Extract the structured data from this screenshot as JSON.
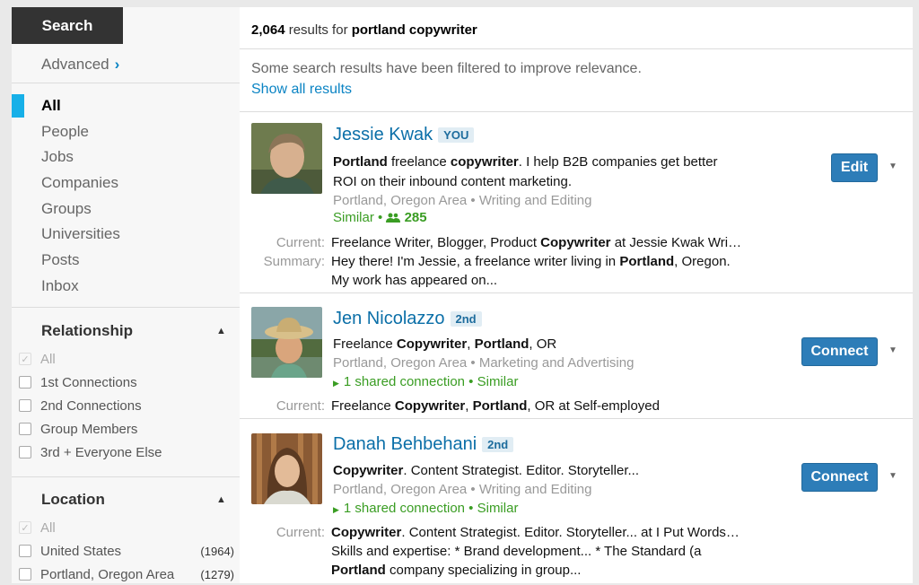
{
  "sidebar": {
    "search_tab": "Search",
    "advanced_label": "Advanced",
    "advanced_chevron": "›",
    "nav_items": [
      {
        "label": "All",
        "active": true
      },
      {
        "label": "People"
      },
      {
        "label": "Jobs"
      },
      {
        "label": "Companies"
      },
      {
        "label": "Groups"
      },
      {
        "label": "Universities"
      },
      {
        "label": "Posts"
      },
      {
        "label": "Inbox"
      }
    ],
    "relationship": {
      "title": "Relationship",
      "caret": "▲",
      "options": [
        {
          "label": "All",
          "checked": true,
          "disabled": true
        },
        {
          "label": "1st Connections"
        },
        {
          "label": "2nd Connections"
        },
        {
          "label": "Group Members"
        },
        {
          "label": "3rd + Everyone Else"
        }
      ]
    },
    "location": {
      "title": "Location",
      "caret": "▲",
      "options": [
        {
          "label": "All",
          "checked": true,
          "disabled": true
        },
        {
          "label": "United States",
          "count": "(1964)"
        },
        {
          "label": "Portland, Oregon Area",
          "count": "(1279)"
        }
      ]
    }
  },
  "main": {
    "results_count": "2,064",
    "results_for": " results for ",
    "query": "portland copywriter",
    "filtered_message": "Some search results have been filtered to improve relevance.",
    "show_all_link": "Show all results",
    "results": [
      {
        "name": "Jessie Kwak",
        "badge": "YOU",
        "headline_parts": [
          {
            "text": "Portland",
            "bold": true
          },
          {
            "text": " freelance "
          },
          {
            "text": "copywriter",
            "bold": true
          },
          {
            "text": ". I help B2B companies get better"
          }
        ],
        "headline_line2": "ROI on their inbound content marketing.",
        "location": "Portland, Oregon Area • Writing and Editing",
        "similar_label": "Similar • ",
        "connections_icon": "people-icon",
        "connections_count": "285",
        "current_label": "Current:",
        "current_parts": [
          {
            "text": "Freelance Writer, Blogger, Product "
          },
          {
            "text": "Copywriter",
            "bold": true
          },
          {
            "text": " at Jessie Kwak Wri…"
          }
        ],
        "summary_label": "Summary:",
        "summary_parts": [
          {
            "text": "Hey there! I'm Jessie, a freelance writer living in "
          },
          {
            "text": "Portland",
            "bold": true
          },
          {
            "text": ", Oregon."
          }
        ],
        "summary_line2": "My work has appeared on...",
        "button_label": "Edit",
        "dropdown": "▼"
      },
      {
        "name": "Jen Nicolazzo",
        "badge": "2nd",
        "headline_parts": [
          {
            "text": "Freelance "
          },
          {
            "text": "Copywriter",
            "bold": true
          },
          {
            "text": ", "
          },
          {
            "text": "Portland",
            "bold": true
          },
          {
            "text": ", OR"
          }
        ],
        "location": "Portland, Oregon Area • Marketing and Advertising",
        "shared_text": "1 shared connection • Similar",
        "current_label": "Current:",
        "current_parts": [
          {
            "text": "Freelance "
          },
          {
            "text": "Copywriter",
            "bold": true
          },
          {
            "text": ", "
          },
          {
            "text": "Portland",
            "bold": true
          },
          {
            "text": ", OR at Self-employed"
          }
        ],
        "button_label": "Connect",
        "dropdown": "▼"
      },
      {
        "name": "Danah Behbehani",
        "badge": "2nd",
        "headline_parts": [
          {
            "text": "Copywriter",
            "bold": true
          },
          {
            "text": ". Content Strategist. Editor. Storyteller..."
          }
        ],
        "location": "Portland, Oregon Area • Writing and Editing",
        "shared_text": "1 shared connection • Similar",
        "current_label": "Current:",
        "current_parts": [
          {
            "text": "Copywriter",
            "bold": true
          },
          {
            "text": ". Content Strategist. Editor. Storyteller... at I Put Words…"
          }
        ],
        "extra_line": "Skills and expertise: * Brand development... * The Standard (a",
        "extra_line2_parts": [
          {
            "text": "Portland",
            "bold": true
          },
          {
            "text": " company specializing in group..."
          }
        ],
        "button_label": "Connect",
        "dropdown": "▼"
      }
    ]
  },
  "colors": {
    "link_blue": "#0b84c4",
    "name_blue": "#0b6fa8",
    "button_blue": "#2d7db8",
    "active_accent": "#17b0e8",
    "green": "#3a9d23"
  }
}
